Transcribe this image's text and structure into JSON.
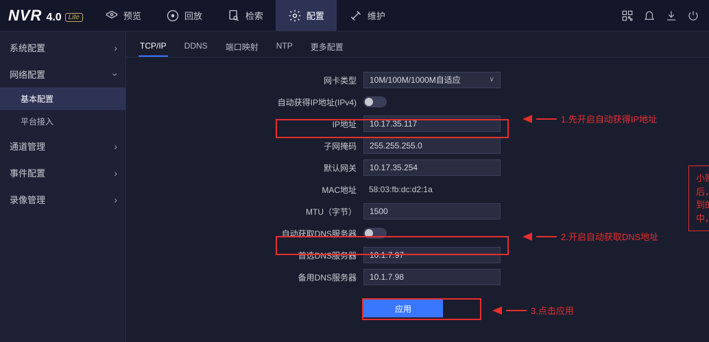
{
  "logo": {
    "main": "NVR",
    "version": "4.0",
    "tag": "Lite"
  },
  "topnav": {
    "preview": "预览",
    "playback": "回放",
    "search": "检索",
    "config": "配置",
    "maintain": "维护"
  },
  "sidebar": {
    "system": {
      "label": "系统配置"
    },
    "network": {
      "label": "网络配置",
      "sub_basic": "基本配置",
      "sub_platform": "平台接入"
    },
    "channel": {
      "label": "通道管理"
    },
    "event": {
      "label": "事件配置"
    },
    "record": {
      "label": "录像管理"
    }
  },
  "subtabs": {
    "tcpip": "TCP/IP",
    "ddns": "DDNS",
    "portmap": "端口映射",
    "ntp": "NTP",
    "more": "更多配置"
  },
  "form": {
    "nic_type": {
      "label": "网卡类型",
      "value": "10M/100M/1000M自适应"
    },
    "auto_ip": {
      "label": "自动获得IP地址(IPv4)"
    },
    "ip": {
      "label": "IP地址",
      "value": "10.17.35.117"
    },
    "mask": {
      "label": "子网掩码",
      "value": "255.255.255.0"
    },
    "gateway": {
      "label": "默认网关",
      "value": "10.17.35.254"
    },
    "mac": {
      "label": "MAC地址",
      "value": "58:03:fb:dc:d2:1a"
    },
    "mtu": {
      "label": "MTU（字节）",
      "value": "1500"
    },
    "auto_dns": {
      "label": "自动获取DNS服务器"
    },
    "dns1": {
      "label": "首选DNS服务器",
      "value": "10.1.7.97"
    },
    "dns2": {
      "label": "备用DNS服务器",
      "value": "10.1.7.98"
    },
    "apply": "应用"
  },
  "annotations": {
    "a1": "1.先开启自动获得IP地址",
    "a2": "2.开启自动获取DNS地址",
    "a3": "3.点击应用",
    "tip": "小贴士：建议获取到IP和DNS后，再取消自动获取，将获取到的参数信息固定到网络参数中，点击应用"
  }
}
